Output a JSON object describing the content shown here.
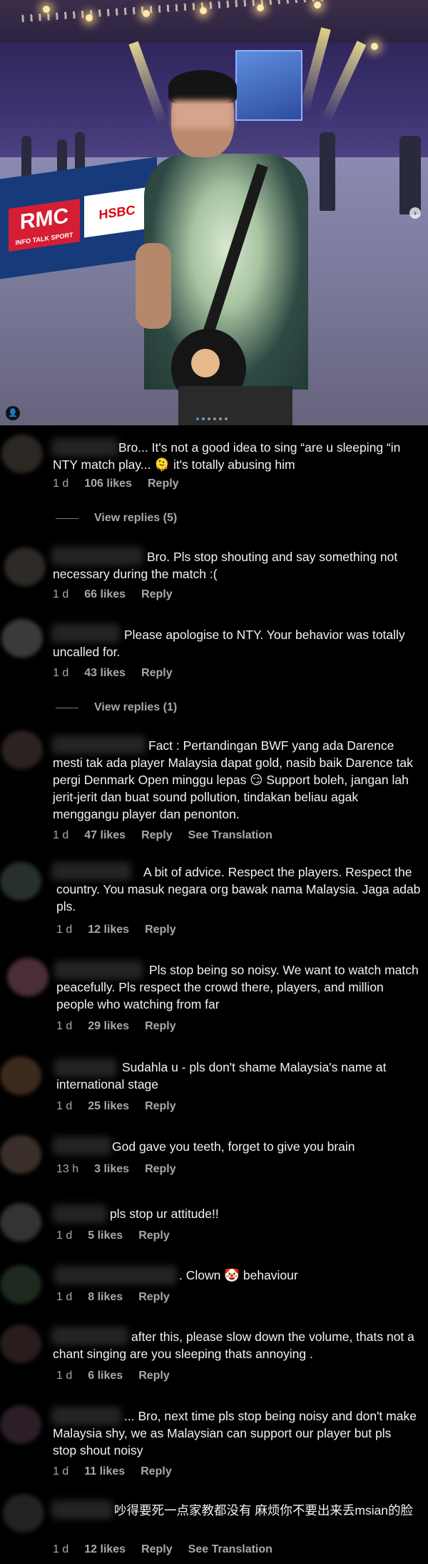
{
  "photo": {
    "ads": {
      "rmc": "RMC",
      "rmc_sub": "INFO TALK SPORT",
      "hsbc": "HSBC"
    },
    "carousel_dots": 6,
    "carousel_active_index": 0,
    "icons": {
      "next": "chevron-right-icon",
      "user_tag": "person-icon"
    }
  },
  "comments": [
    {
      "text": "Bro... It's not a good idea to sing “are u sleeping “in NTY match play... 🫠 it's totally abusing him",
      "time": "1 d",
      "likes": "106 likes",
      "reply": "Reply",
      "view_replies": "View replies (5)"
    },
    {
      "text": "Bro. Pls stop shouting and say something not necessary during the match :(",
      "time": "1 d",
      "likes": "66 likes",
      "reply": "Reply"
    },
    {
      "text": "Please apologise to NTY. Your behavior was totally uncalled for.",
      "time": "1 d",
      "likes": "43 likes",
      "reply": "Reply",
      "view_replies": "View replies (1)"
    },
    {
      "text": "Fact : Pertandingan BWF yang ada Darence mesti tak ada player Malaysia dapat gold, nasib baik Darence tak pergi Denmark Open minggu lepas 😏 Support boleh, jangan lah jerit-jerit dan buat sound pollution, tindakan beliau agak menggangu player dan penonton.",
      "time": "1 d",
      "likes": "47 likes",
      "reply": "Reply",
      "translate": "See Translation"
    },
    {
      "text": "A bit of advice. Respect the players. Respect the country. You masuk negara org bawak nama Malaysia. Jaga adab pls.",
      "time": "1 d",
      "likes": "12 likes",
      "reply": "Reply"
    },
    {
      "text": "Pls stop being so noisy. We want to watch match peacefully. Pls respect the crowd there, players, and million people who watching from far",
      "time": "1 d",
      "likes": "29 likes",
      "reply": "Reply"
    },
    {
      "text": "Sudahla u - pls don't shame Malaysia's name at international stage",
      "time": "1 d",
      "likes": "25 likes",
      "reply": "Reply"
    },
    {
      "text": "God gave you teeth, forget to give you brain",
      "time": "13 h",
      "likes": "3 likes",
      "reply": "Reply"
    },
    {
      "text": "pls stop ur attitude!!",
      "time": "1 d",
      "likes": "5 likes",
      "reply": "Reply"
    },
    {
      "text": ". Clown 🤡 behaviour",
      "time": "1 d",
      "likes": "8 likes",
      "reply": "Reply"
    },
    {
      "text": "after this, please slow down the volume, thats not a chant singing are you sleeping thats annoying .",
      "time": "1 d",
      "likes": "6 likes",
      "reply": "Reply"
    },
    {
      "text": "... Bro, next time pls stop being noisy and don't make Malaysia shy, we as Malaysian can support our player but pls stop shout noisy",
      "time": "1 d",
      "likes": "11 likes",
      "reply": "Reply"
    },
    {
      "text": "吵得要死一点家教都没有 麻烦你不要出来丢msian的脸",
      "time": "1 d",
      "likes": "12 likes",
      "reply": "Reply",
      "translate": "See Translation"
    }
  ]
}
